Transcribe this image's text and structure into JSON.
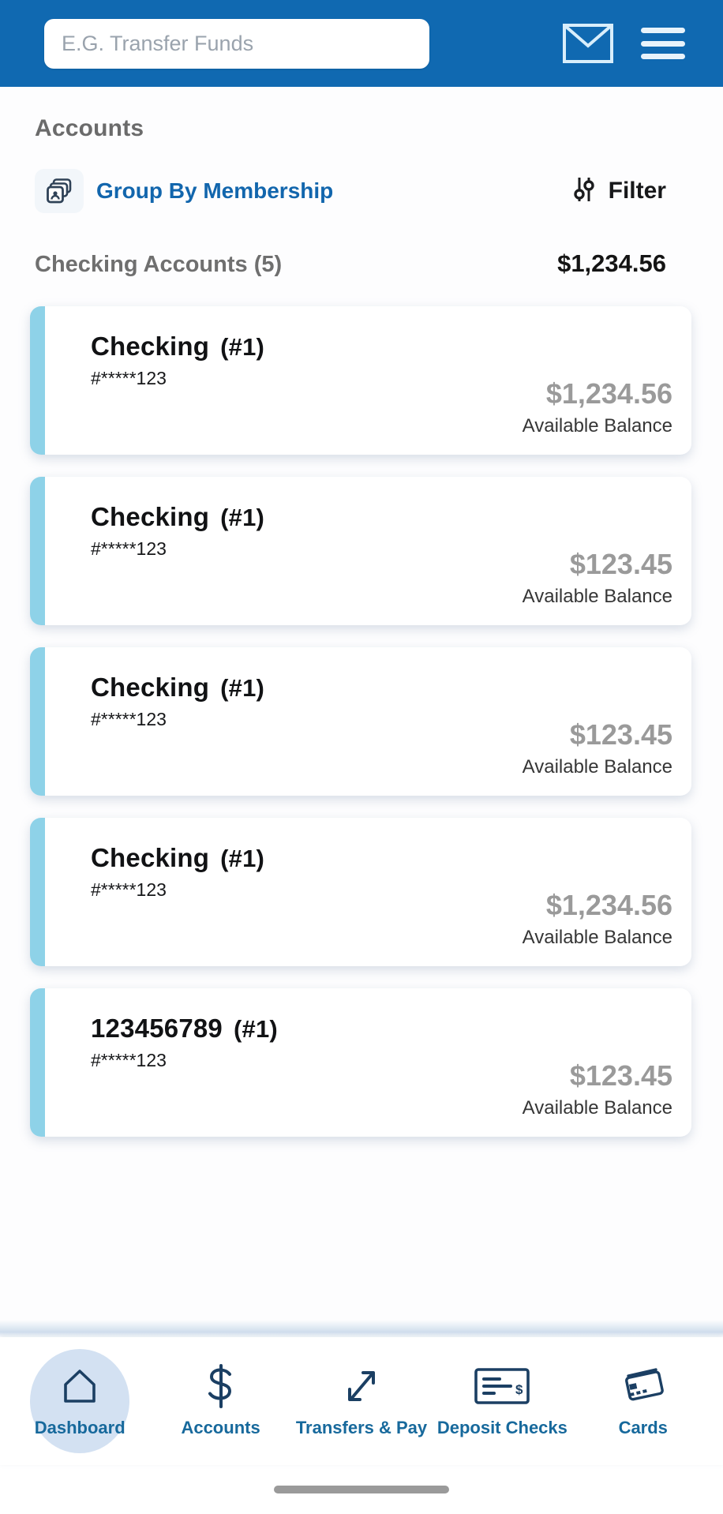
{
  "header": {
    "search_placeholder": "E.G. Transfer Funds",
    "search_value": "",
    "mail_icon": "envelope-icon",
    "menu_icon": "hamburger-menu-icon"
  },
  "page": {
    "title": "Accounts"
  },
  "toolbar": {
    "group_by_label": "Group By Membership",
    "group_by_icon": "stacked-cards-icon",
    "filter_label": "Filter",
    "filter_icon": "sliders-icon"
  },
  "section": {
    "name": "Checking Accounts (5)",
    "total": "$1,234.56"
  },
  "accounts": [
    {
      "name": "Checking",
      "tag": "(#1)",
      "mask": "#*****123",
      "balance": "$1,234.56",
      "balance_label": "Available Balance"
    },
    {
      "name": "Checking",
      "tag": "(#1)",
      "mask": "#*****123",
      "balance": "$123.45",
      "balance_label": "Available Balance"
    },
    {
      "name": "Checking",
      "tag": "(#1)",
      "mask": "#*****123",
      "balance": "$123.45",
      "balance_label": "Available Balance"
    },
    {
      "name": "Checking",
      "tag": "(#1)",
      "mask": "#*****123",
      "balance": "$1,234.56",
      "balance_label": "Available Balance"
    },
    {
      "name": "123456789",
      "tag": "(#1)",
      "mask": "#*****123",
      "balance": "$123.45",
      "balance_label": "Available Balance"
    }
  ],
  "bottom_nav": {
    "items": [
      {
        "label": "Dashboard",
        "icon": "home-icon",
        "active": true
      },
      {
        "label": "Accounts",
        "icon": "dollar-sign-icon",
        "active": false
      },
      {
        "label": "Transfers & Pay",
        "icon": "transfer-arrows-icon",
        "active": false
      },
      {
        "label": "Deposit Checks",
        "icon": "check-deposit-icon",
        "active": false
      },
      {
        "label": "Cards",
        "icon": "credit-cards-icon",
        "active": false
      }
    ]
  },
  "colors": {
    "header_blue": "#1069b1",
    "accent_blue": "#1266ad",
    "card_accent": "#8ed2e8",
    "nav_icon": "#1b3f63",
    "nav_label": "#17699c",
    "nav_active_pill": "#d3e1f2",
    "balance_gray": "#9a9a9a"
  }
}
